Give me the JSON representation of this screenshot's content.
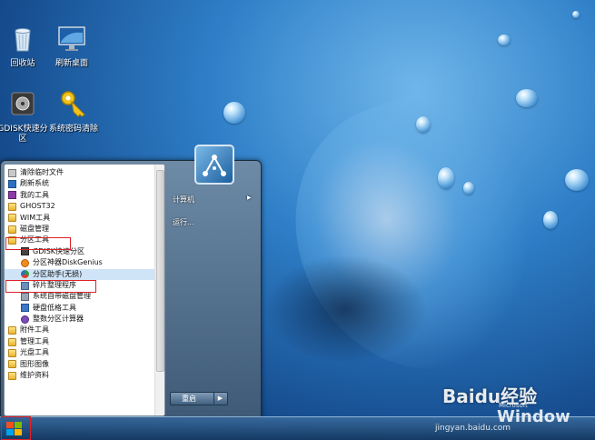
{
  "desktop_icons": [
    {
      "name": "recycle-bin",
      "label": "回收站"
    },
    {
      "name": "refresh-desktop",
      "label": "刷新桌面"
    },
    {
      "name": "gdisk",
      "label": "GDISK快速分区"
    },
    {
      "name": "password-reset",
      "label": "系统密码清除"
    }
  ],
  "start_menu": {
    "programs": [
      {
        "label": "清除临时文件",
        "icon": "cleanup-icon",
        "sub": false
      },
      {
        "label": "刷新系统",
        "icon": "refresh-icon",
        "sub": false
      },
      {
        "label": "我的工具",
        "icon": "tools-icon",
        "sub": false
      },
      {
        "label": "GHOST32",
        "icon": "folder-icon",
        "sub": false
      },
      {
        "label": "WIM工具",
        "icon": "folder-icon",
        "sub": false
      },
      {
        "label": "磁盘管理",
        "icon": "folder-icon",
        "sub": false
      },
      {
        "label": "分区工具",
        "icon": "folder-icon",
        "sub": false
      },
      {
        "label": "GDISK快速分区",
        "icon": "gdisk-icon",
        "sub": true
      },
      {
        "label": "分区神器DiskGenius",
        "icon": "diskgenius-icon",
        "sub": true
      },
      {
        "label": "分区助手(无损)",
        "icon": "partition-assistant-icon",
        "sub": true
      },
      {
        "label": "碎片整理程序",
        "icon": "defrag-icon",
        "sub": true
      },
      {
        "label": "系统自带磁盘管理",
        "icon": "disk-management-icon",
        "sub": true
      },
      {
        "label": "硬盘低格工具",
        "icon": "lowformat-icon",
        "sub": true
      },
      {
        "label": "整数分区计算器",
        "icon": "calculator-icon",
        "sub": true
      },
      {
        "label": "附件工具",
        "icon": "folder-icon",
        "sub": false
      },
      {
        "label": "管理工具",
        "icon": "folder-icon",
        "sub": false
      },
      {
        "label": "光盘工具",
        "icon": "folder-icon",
        "sub": false
      },
      {
        "label": "图形图像",
        "icon": "folder-icon",
        "sub": false
      },
      {
        "label": "维护资料",
        "icon": "folder-icon",
        "sub": false
      }
    ],
    "right_items": [
      {
        "label": "计算机",
        "arrow": "▶"
      },
      {
        "label": "运行..."
      }
    ],
    "shutdown_label": "重启",
    "shutdown_arrow": "▶"
  },
  "watermark": {
    "brand": "Baidu经验",
    "url": "jingyan.baidu.com",
    "os_text": "Window",
    "os_small": "Microsoft"
  },
  "colors": {
    "highlight_box": "#e0202a",
    "selected_row": "#cfe4f7"
  }
}
